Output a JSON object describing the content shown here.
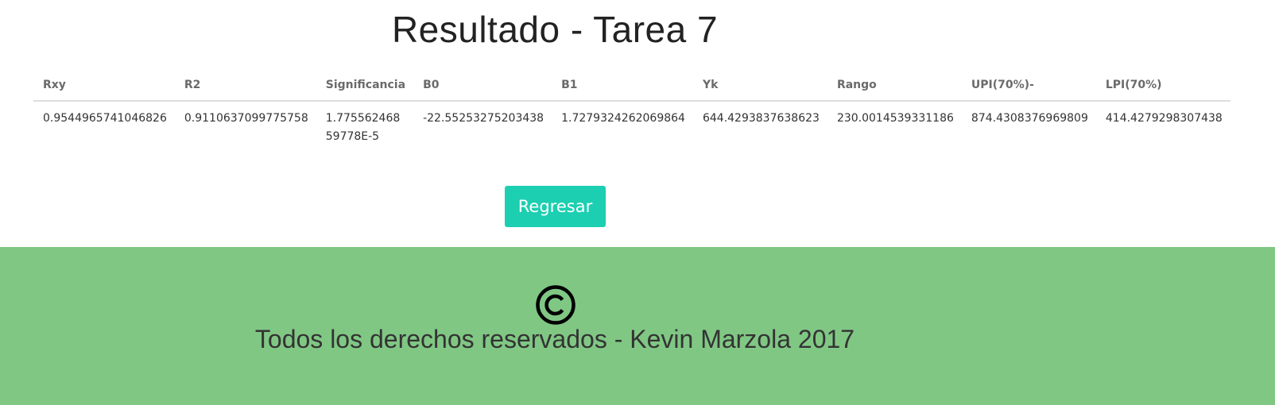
{
  "page": {
    "title": "Resultado - Tarea 7"
  },
  "table": {
    "headers": [
      "Rxy",
      "R2",
      "Significancia",
      "B0",
      "B1",
      "Yk",
      "Rango",
      "UPI(70%)-",
      "LPI(70%)"
    ],
    "row": [
      "0.9544965741046826",
      "0.9110637099775758",
      "1.77556246859778E-5",
      "-22.55253275203438",
      "1.7279324262069864",
      "644.4293837638623",
      "230.0014539331186",
      "874.4308376969809",
      "414.4279298307438"
    ]
  },
  "actions": {
    "back_label": "Regresar"
  },
  "footer": {
    "icon": "copyright-icon",
    "text": "Todos los derechos reservados - Kevin Marzola 2017"
  },
  "colors": {
    "button": "#1ccfb1",
    "footer": "#80c784"
  }
}
